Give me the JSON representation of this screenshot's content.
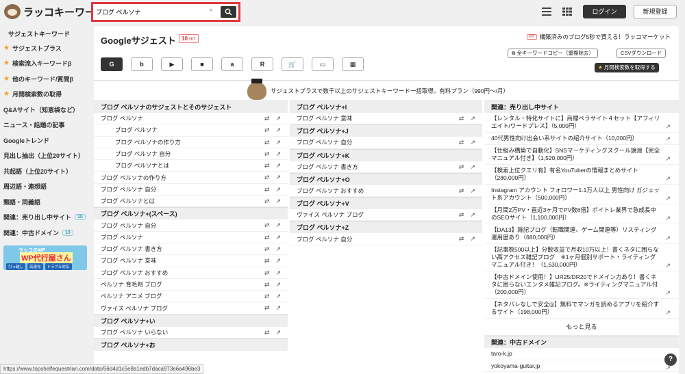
{
  "app": {
    "logo_text": "ラッコキーワード"
  },
  "search": {
    "value": "ブログ ペルソナ",
    "clear_glyph": "×"
  },
  "header": {
    "login_label": "ログイン",
    "register_label": "新規登録"
  },
  "sidebar": {
    "heading": "サジェストキーワード",
    "items": [
      {
        "label": "サジェストプラス",
        "star": true
      },
      {
        "label": "検索流入キーワードβ",
        "star": true
      },
      {
        "label": "他のキーワード/質問β",
        "star": true
      },
      {
        "label": "月間検索数の取得",
        "star": true
      },
      {
        "label": "Q&Aサイト（知恵袋など）"
      },
      {
        "label": "ニュース・話題の記事"
      },
      {
        "label": "Googleトレンド"
      },
      {
        "label": "見出し抽出（上位20サイト）"
      },
      {
        "label": "共起語（上位20サイト）"
      },
      {
        "label": "周辺語・連想語"
      },
      {
        "label": "類語・同義語"
      },
      {
        "label": "関連：売り出し中サイト",
        "badge": "10"
      },
      {
        "label": "関連：中古ドメイン",
        "badge": "10"
      }
    ],
    "banner": {
      "line1": "ラッコのWP",
      "line2": "WP代行屋さん",
      "tags": [
        "引っ越し",
        "高速化",
        "トラブル対応"
      ]
    }
  },
  "main": {
    "title": "Googleサジェスト",
    "hit_count": "10",
    "hit_suffix": "HIT",
    "promo_badge": "PR",
    "promo_text": "構築済みのブログ5秒で買える！ラッコマーケット",
    "copy_all_label": "全キーワードコピー（重複除去）",
    "csv_label": "CSVダウンロード",
    "monthly_label": "月間検索数を取得する",
    "engines": [
      "G",
      "b",
      "▶",
      "■",
      "a",
      "R",
      "🛒",
      "▭",
      "▦"
    ],
    "notice": "サジェストプラスで数千以上のサジェストキーワード一括取得。有料プラン（990円〜/月）"
  },
  "col1": [
    {
      "head": "ブログ ペルソナのサジェストとそのサジェスト",
      "rows": [
        {
          "t": "ブログ ペルソナ",
          "i": false
        },
        {
          "t": "ブログ ペルソナ",
          "i": true
        },
        {
          "t": "ブログ ペルソナの作り方",
          "i": true
        },
        {
          "t": "ブログ ペルソナ 自分",
          "i": true
        },
        {
          "t": "ブログ ペルソナとは",
          "i": true
        },
        {
          "t": "ブログ ペルソナの作り方",
          "i": false
        },
        {
          "t": "ブログ ペルソナ 自分",
          "i": false
        },
        {
          "t": "ブログ ペルソナとは",
          "i": false
        }
      ]
    },
    {
      "head": "ブログ ペルソナ+(スペース)",
      "rows": [
        {
          "t": "ブログ ペルソナ 自分"
        },
        {
          "t": "ブログ ペルソナ"
        },
        {
          "t": "ブログ ペルソナ 書き方"
        },
        {
          "t": "ブログ ペルソナ 意味"
        },
        {
          "t": "ブログ ペルソナ おすすめ"
        },
        {
          "t": "ペルソナ 育毛剤 ブログ"
        },
        {
          "t": "ペルソナ アニメ ブログ"
        },
        {
          "t": "ヴァイス ペルソナ ブログ"
        }
      ]
    },
    {
      "head": "ブログ ペルソナ+い",
      "rows": [
        {
          "t": "ブログ ペルソナ いらない"
        }
      ]
    },
    {
      "head": "ブログ ペルソナ+お",
      "rows": []
    }
  ],
  "col2": [
    {
      "head": "ブログ ペルソナ+I",
      "rows": [
        {
          "t": "ブログ ペルソナ 意味"
        }
      ]
    },
    {
      "head": "ブログ ペルソナ+J",
      "rows": [
        {
          "t": "ブログ ペルソナ 自分"
        }
      ]
    },
    {
      "head": "ブログ ペルソナ+K",
      "rows": [
        {
          "t": "ブログ ペルソナ 書き方"
        }
      ]
    },
    {
      "head": "ブログ ペルソナ+O",
      "rows": [
        {
          "t": "ブログ ペルソナ おすすめ"
        }
      ]
    },
    {
      "head": "ブログ ペルソナ+V",
      "rows": [
        {
          "t": "ヴァイス ペルソナ ブログ"
        }
      ]
    },
    {
      "head": "ブログ ペルソナ+Z",
      "rows": [
        {
          "t": "ブログ ペルソナ 自分"
        }
      ]
    }
  ],
  "col3": {
    "head1": "関連：売り出し中サイト",
    "sites": [
      "【レンタル・特化サイトに】商標ペラサイト４セット【アフィリエイト/ワードプレス】（5,000円）",
      "40代男性向け出会い系サイトの紹介サイト（10,000円）",
      "【仕組み構築で自動化】SNSマーケティングスクール譲渡【完全マニュアル付き】（1,520,000円）",
      "【検索上位クエリ有】有名YouTuberの情報まとめサイト（280,000円）",
      "Instagram アカウント フォロワー1.1万人以上 男性向け ガジェット系アカウント（500,000円）",
      "【月間2万PV・直近3ヶ月でPV数6倍】ポイトレ業界で急成長中のSEOサイト（1,100,000円）",
      "【DA13】雑記ブログ（転職関連、ゲーム関連等）リスティング運用歴あり（680,000円）",
      "【記事数500以上】分散収益で月収10万以上！書くネタに困らない高アクセス雑記ブログ　※1ヶ月個別サポート・ライティングマニュアル付き！（1,530,000円）",
      "【中古ドメイン使用！】UR25/DR20でドメイン力あり！書くネタに困らないエンタメ雑記ブログ。※ライティングマニュアル付（200,000円）",
      "【ネタバレなしで安全◎】無料でマンガを読めるアプリを紹介するサイト（198,000円）"
    ],
    "more_label": "もっと見る",
    "head2": "関連：中古ドメイン",
    "domains": [
      "taro-k.jp",
      "yokoyama-guitar.jp"
    ]
  },
  "status_url": "https://www.topshelfequestrian.com/data/56d4d1c5e8a1edb7daca973e6a496be3",
  "help_glyph": "?",
  "colors": {
    "accent_red": "#e0363d",
    "dark": "#333333",
    "star": "#f0a020"
  }
}
